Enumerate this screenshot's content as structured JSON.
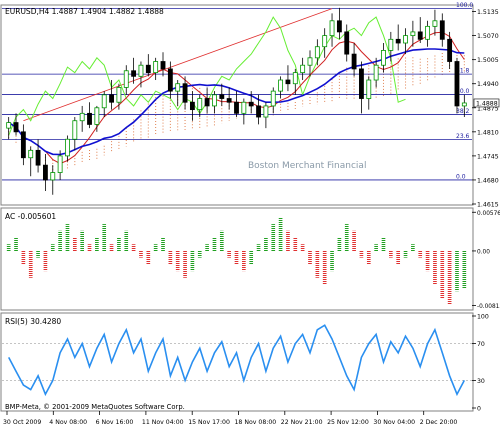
{
  "header": {
    "symbol_info": "EURUSD,H4  1.4887 1.4904 1.4882 1.4888"
  },
  "watermark": "Boston Merchant Financial",
  "colors": {
    "bull_candle": "#00cc00",
    "bear_candle": "#000000",
    "ma_red": "#d02020",
    "kijun_blue": "#1010d0",
    "chikou_green": "#66ee33",
    "cloud_dots": "#e08050",
    "fib_line": "#2020a0",
    "trend_line": "#e03030",
    "ac_up": "#20a020",
    "ac_down": "#e03030",
    "rsi_line": "#2a8ff0",
    "grid": "#b0b0b0"
  },
  "price_panel": {
    "y_ticks": [
      "1.5135",
      "1.5070",
      "1.5005",
      "1.4940",
      "1.4875",
      "1.4810",
      "1.4745",
      "1.4680",
      "1.4615"
    ],
    "current_price_label": "1.4888",
    "fib_levels": [
      {
        "label": "100.0",
        "price": 1.5143
      },
      {
        "label": "61.8",
        "price": 1.4966
      },
      {
        "label": "50.0",
        "price": 1.4911
      },
      {
        "label": "38.2",
        "price": 1.4857
      },
      {
        "label": "23.6",
        "price": 1.4789
      },
      {
        "label": "0.0",
        "price": 1.468
      }
    ]
  },
  "ac_panel": {
    "title": "AC -0.005601",
    "y_ticks": [
      "0.005761",
      "0.00",
      "-0.00813"
    ]
  },
  "rsi_panel": {
    "title": "RSI(5) 30.4280",
    "y_ticks": [
      "100",
      "70",
      "30",
      "0"
    ],
    "copyright": "BMP-Meta, © 2001-2009 MetaQuotes Software Corp."
  },
  "time_axis": {
    "labels": [
      "30 Oct 2009",
      "4 Nov 08:00",
      "6 Nov 16:00",
      "11 Nov 04:00",
      "15 Nov 17:00",
      "18 Nov 08:00",
      "22 Nov 21:00",
      "25 Nov 12:00",
      "30 Nov 04:00",
      "2 Dec 20:00"
    ]
  },
  "chart_data": {
    "type": "candlestick",
    "symbol": "EURUSD",
    "timeframe": "H4",
    "ylim": [
      1.4615,
      1.515
    ],
    "candles_ohlc": [
      [
        1.482,
        1.485,
        1.479,
        1.4835
      ],
      [
        1.4835,
        1.486,
        1.48,
        1.481
      ],
      [
        1.481,
        1.483,
        1.472,
        1.474
      ],
      [
        1.474,
        1.477,
        1.469,
        1.476
      ],
      [
        1.476,
        1.479,
        1.47,
        1.472
      ],
      [
        1.472,
        1.475,
        1.465,
        1.468
      ],
      [
        1.468,
        1.472,
        1.464,
        1.47
      ],
      [
        1.47,
        1.476,
        1.468,
        1.4745
      ],
      [
        1.4745,
        1.48,
        1.473,
        1.479
      ],
      [
        1.479,
        1.485,
        1.476,
        1.484
      ],
      [
        1.484,
        1.488,
        1.481,
        1.486
      ],
      [
        1.486,
        1.489,
        1.482,
        1.483
      ],
      [
        1.483,
        1.488,
        1.481,
        1.4875
      ],
      [
        1.4875,
        1.492,
        1.485,
        1.491
      ],
      [
        1.491,
        1.495,
        1.487,
        1.489
      ],
      [
        1.489,
        1.494,
        1.487,
        1.493
      ],
      [
        1.493,
        1.499,
        1.491,
        1.4975
      ],
      [
        1.4975,
        1.501,
        1.494,
        1.496
      ],
      [
        1.496,
        1.5,
        1.493,
        1.499
      ],
      [
        1.499,
        1.502,
        1.496,
        1.497
      ],
      [
        1.497,
        1.501,
        1.495,
        1.5
      ],
      [
        1.5,
        1.5025,
        1.496,
        1.498
      ],
      [
        1.498,
        1.5,
        1.49,
        1.492
      ],
      [
        1.492,
        1.495,
        1.488,
        1.494
      ],
      [
        1.494,
        1.496,
        1.487,
        1.489
      ],
      [
        1.489,
        1.492,
        1.484,
        1.487
      ],
      [
        1.487,
        1.491,
        1.485,
        1.49
      ],
      [
        1.49,
        1.493,
        1.486,
        1.488
      ],
      [
        1.488,
        1.492,
        1.486,
        1.491
      ],
      [
        1.491,
        1.494,
        1.488,
        1.49
      ],
      [
        1.49,
        1.493,
        1.487,
        1.489
      ],
      [
        1.489,
        1.492,
        1.485,
        1.486
      ],
      [
        1.486,
        1.49,
        1.483,
        1.489
      ],
      [
        1.489,
        1.492,
        1.486,
        1.488
      ],
      [
        1.488,
        1.491,
        1.483,
        1.485
      ],
      [
        1.485,
        1.489,
        1.482,
        1.488
      ],
      [
        1.488,
        1.493,
        1.486,
        1.492
      ],
      [
        1.492,
        1.496,
        1.49,
        1.495
      ],
      [
        1.495,
        1.499,
        1.492,
        1.494
      ],
      [
        1.494,
        1.498,
        1.491,
        1.497
      ],
      [
        1.497,
        1.501,
        1.495,
        1.499
      ],
      [
        1.499,
        1.503,
        1.496,
        1.501
      ],
      [
        1.501,
        1.506,
        1.499,
        1.504
      ],
      [
        1.504,
        1.509,
        1.501,
        1.507
      ],
      [
        1.507,
        1.513,
        1.504,
        1.511
      ],
      [
        1.511,
        1.5145,
        1.506,
        1.508
      ],
      [
        1.508,
        1.51,
        1.5,
        1.502
      ],
      [
        1.502,
        1.505,
        1.496,
        1.498
      ],
      [
        1.498,
        1.5,
        1.486,
        1.49
      ],
      [
        1.49,
        1.496,
        1.487,
        1.495
      ],
      [
        1.495,
        1.501,
        1.493,
        1.499
      ],
      [
        1.499,
        1.505,
        1.497,
        1.503
      ],
      [
        1.503,
        1.508,
        1.5,
        1.506
      ],
      [
        1.506,
        1.51,
        1.503,
        1.505
      ],
      [
        1.505,
        1.509,
        1.502,
        1.507
      ],
      [
        1.507,
        1.511,
        1.504,
        1.508
      ],
      [
        1.508,
        1.512,
        1.505,
        1.506
      ],
      [
        1.506,
        1.511,
        1.504,
        1.5095
      ],
      [
        1.5095,
        1.514,
        1.507,
        1.511
      ],
      [
        1.511,
        1.513,
        1.504,
        1.506
      ],
      [
        1.506,
        1.508,
        1.498,
        1.5
      ],
      [
        1.5,
        1.501,
        1.486,
        1.488
      ],
      [
        1.488,
        1.491,
        1.485,
        1.4888
      ]
    ],
    "rsi_values": [
      55,
      40,
      25,
      20,
      35,
      15,
      30,
      60,
      75,
      55,
      70,
      45,
      65,
      80,
      50,
      70,
      85,
      60,
      75,
      40,
      60,
      75,
      35,
      55,
      30,
      50,
      65,
      40,
      60,
      72,
      45,
      60,
      30,
      55,
      70,
      40,
      65,
      78,
      50,
      70,
      80,
      60,
      85,
      90,
      75,
      55,
      35,
      20,
      55,
      70,
      80,
      50,
      72,
      60,
      78,
      65,
      45,
      70,
      85,
      60,
      35,
      15,
      30
    ],
    "ac_values": [
      0.001,
      0.002,
      -0.002,
      -0.004,
      -0.001,
      -0.003,
      0.001,
      0.003,
      0.004,
      0.002,
      0.003,
      0.001,
      0.002,
      0.004,
      0.001,
      0.002,
      0.003,
      0.001,
      -0.001,
      -0.002,
      0.001,
      0.002,
      -0.002,
      -0.003,
      -0.004,
      -0.003,
      -0.001,
      0.001,
      0.002,
      0.003,
      -0.001,
      -0.002,
      -0.003,
      -0.002,
      0.001,
      0.002,
      0.004,
      0.005,
      0.003,
      0.002,
      0.001,
      -0.002,
      -0.004,
      -0.005,
      -0.003,
      0.002,
      0.004,
      0.003,
      -0.001,
      -0.002,
      0.001,
      0.002,
      -0.001,
      -0.002,
      -0.001,
      0.001,
      -0.001,
      -0.003,
      -0.005,
      -0.007,
      -0.008,
      -0.006,
      -0.0056
    ]
  }
}
